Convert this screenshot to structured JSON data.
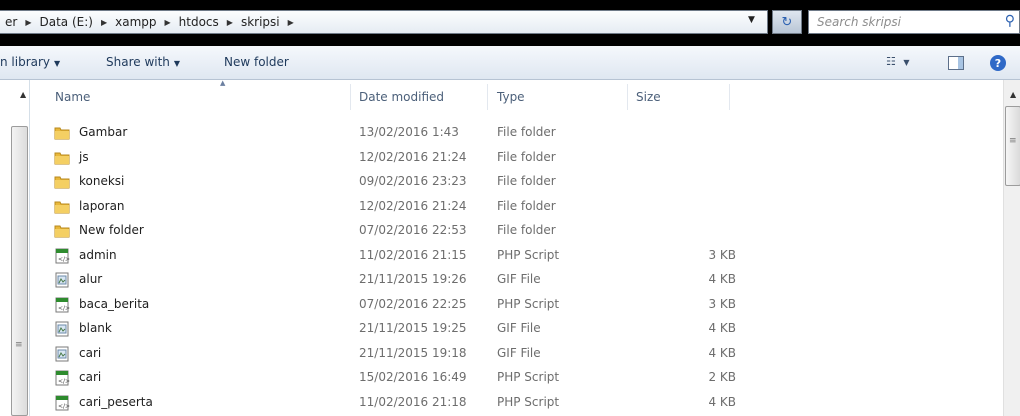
{
  "address_bar": {
    "crumbs": [
      "er",
      "Data (E:)",
      "xampp",
      "htdocs",
      "skripsi"
    ],
    "search_placeholder": "Search skripsi"
  },
  "toolbar": {
    "include_library": "n library",
    "share_with": "Share with",
    "new_folder": "New folder"
  },
  "columns": {
    "name": "Name",
    "date_modified": "Date modified",
    "type": "Type",
    "size": "Size"
  },
  "files": [
    {
      "name": "Gambar",
      "date": "13/02/2016 1:43",
      "type": "File folder",
      "size": "",
      "icon": "folder-icon"
    },
    {
      "name": "js",
      "date": "12/02/2016 21:24",
      "type": "File folder",
      "size": "",
      "icon": "folder-icon"
    },
    {
      "name": "koneksi",
      "date": "09/02/2016 23:23",
      "type": "File folder",
      "size": "",
      "icon": "folder-icon"
    },
    {
      "name": "laporan",
      "date": "12/02/2016 21:24",
      "type": "File folder",
      "size": "",
      "icon": "folder-icon"
    },
    {
      "name": "New folder",
      "date": "07/02/2016 22:53",
      "type": "File folder",
      "size": "",
      "icon": "folder-icon"
    },
    {
      "name": "admin",
      "date": "11/02/2016 21:15",
      "type": "PHP Script",
      "size": "3 KB",
      "icon": "php-file-icon"
    },
    {
      "name": "alur",
      "date": "21/11/2015 19:26",
      "type": "GIF File",
      "size": "4 KB",
      "icon": "gif-file-icon"
    },
    {
      "name": "baca_berita",
      "date": "07/02/2016 22:25",
      "type": "PHP Script",
      "size": "3 KB",
      "icon": "php-file-icon"
    },
    {
      "name": "blank",
      "date": "21/11/2015 19:25",
      "type": "GIF File",
      "size": "4 KB",
      "icon": "gif-file-icon"
    },
    {
      "name": "cari",
      "date": "21/11/2015 19:18",
      "type": "GIF File",
      "size": "4 KB",
      "icon": "gif-file-icon"
    },
    {
      "name": "cari",
      "date": "15/02/2016 16:49",
      "type": "PHP Script",
      "size": "2 KB",
      "icon": "php-file-icon"
    },
    {
      "name": "cari_peserta",
      "date": "11/02/2016 21:18",
      "type": "PHP Script",
      "size": "4 KB",
      "icon": "php-file-icon"
    }
  ],
  "colors": {
    "folder": "#e8b73a",
    "accent_blue": "#2c61b1",
    "php_green": "#2e8b2e"
  }
}
